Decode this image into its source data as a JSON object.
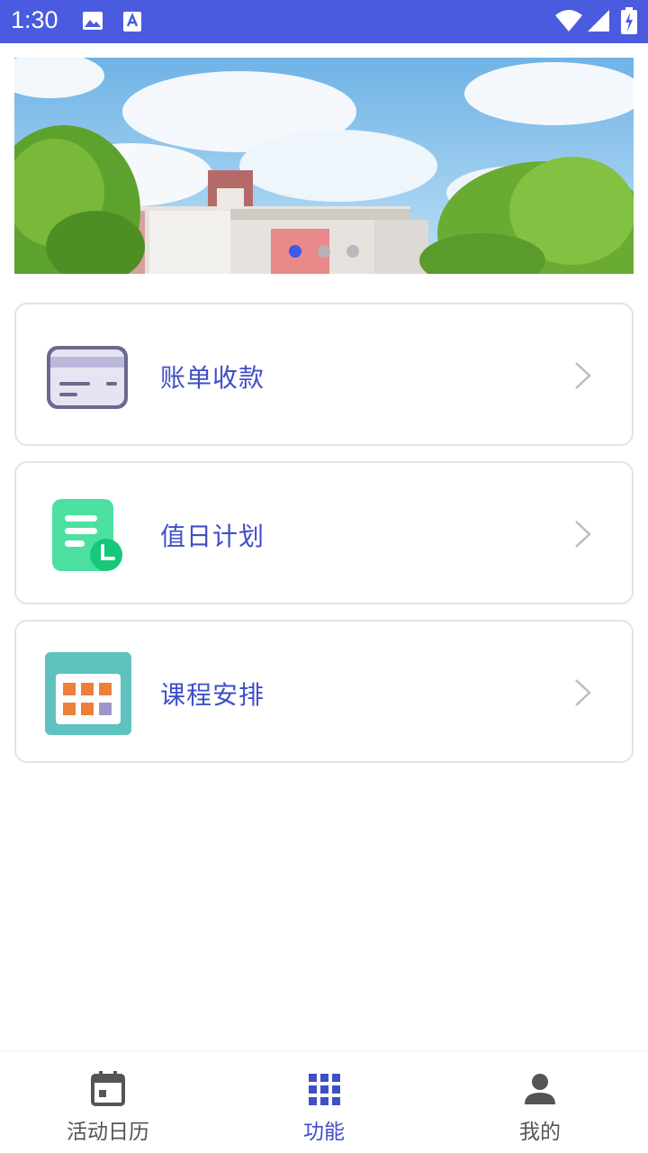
{
  "status_bar": {
    "time": "1:30",
    "background": "#4a5be0",
    "icons": [
      "image-icon",
      "a-letter-icon",
      "wifi-icon",
      "signal-icon",
      "battery-icon"
    ]
  },
  "banner": {
    "carousel_active_index": 0,
    "carousel_count": 3
  },
  "menu": {
    "items": [
      {
        "label": "账单收款",
        "icon": "credit-card-icon"
      },
      {
        "label": "值日计划",
        "icon": "document-clock-icon"
      },
      {
        "label": "课程安排",
        "icon": "calendar-grid-icon"
      }
    ],
    "label_color": "#3f4fc8"
  },
  "bottom_nav": {
    "items": [
      {
        "label": "活动日历",
        "icon": "calendar-icon"
      },
      {
        "label": "功能",
        "icon": "grid-icon",
        "active": true
      },
      {
        "label": "我的",
        "icon": "person-icon"
      }
    ],
    "active_color": "#3f4fc8",
    "inactive_color": "#555555"
  }
}
